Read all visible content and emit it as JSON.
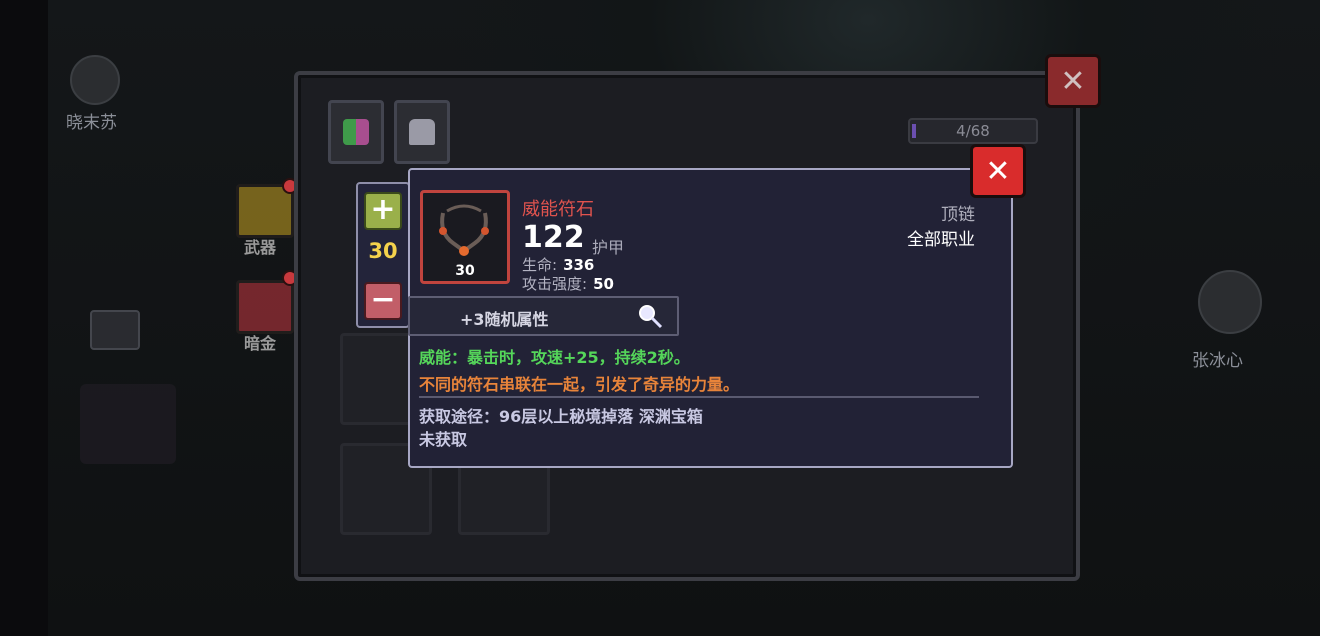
{
  "npcs": {
    "top_left_name": "晓末苏",
    "right_name": "张冰心"
  },
  "side_buttons": [
    {
      "label": "武器",
      "color": "#c9a322"
    },
    {
      "label": "暗金",
      "color": "#b7353d"
    }
  ],
  "inventory": {
    "counter": "4/68"
  },
  "quantity": {
    "plus_symbol": "+",
    "minus_symbol": "−",
    "value": "30"
  },
  "close_symbol": "✕",
  "item": {
    "name": "威能符石",
    "level": "30",
    "main_value": "122",
    "main_value_label": "护甲",
    "stats": [
      {
        "label": "生命:",
        "value": "336"
      },
      {
        "label": "攻击强度:",
        "value": "50"
      }
    ],
    "slot_type": "顶链",
    "class_restriction": "全部职业",
    "random_attr": "+3随机属性",
    "effect_text": "威能：暴击时，攻速+25，持续2秒。",
    "flavor_text": "不同的符石串联在一起，引发了奇异的力量。",
    "source": "获取途径：96层以上秘境掉落 深渊宝箱",
    "status": "未获取"
  },
  "colors": {
    "item_name": "#e0534e",
    "effect": "#55d65a",
    "flavor": "#e8843a",
    "quantity": "#f4d24c",
    "close_button": "#d92c2c"
  }
}
